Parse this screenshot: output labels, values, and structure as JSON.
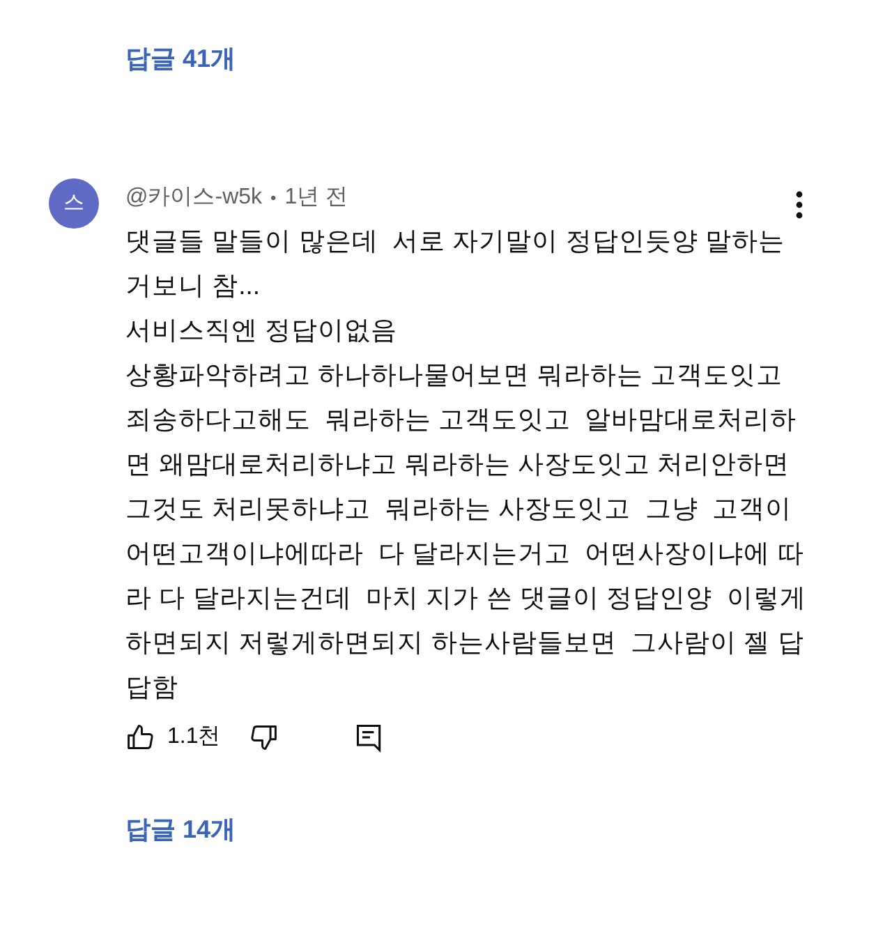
{
  "previous_thread": {
    "replies_label": "답글 41개"
  },
  "comment": {
    "avatar_letter": "스",
    "author": "@카이스-w5k",
    "separator": "•",
    "time": "1년 전",
    "body_lines": [
      "댓글들 말들이 많은데  서로 자기말이 정답인듯양 말하는",
      "거보니 참...",
      "서비스직엔 정답이없음",
      "상황파악하려고 하나하나물어보면 뭐라하는 고객도잇고",
      "죄송하다고해도  뭐라하는 고객도잇고  알바맘대로처리하",
      "면 왜맘대로처리하냐고 뭐라하는 사장도잇고 처리안하면",
      "그것도 처리못하냐고  뭐라하는 사장도잇고  그냥  고객이",
      "어떤고객이냐에따라  다 달라지는거고  어떤사장이냐에 따",
      "라 다 달라지는건데  마치 지가 쓴 댓글이 정답인양  이렇게",
      "하면되지 저렇게하면되지 하는사람들보면  그사람이 젤 답",
      "답함"
    ],
    "likes": "1.1천",
    "replies_label": "답글 14개"
  }
}
